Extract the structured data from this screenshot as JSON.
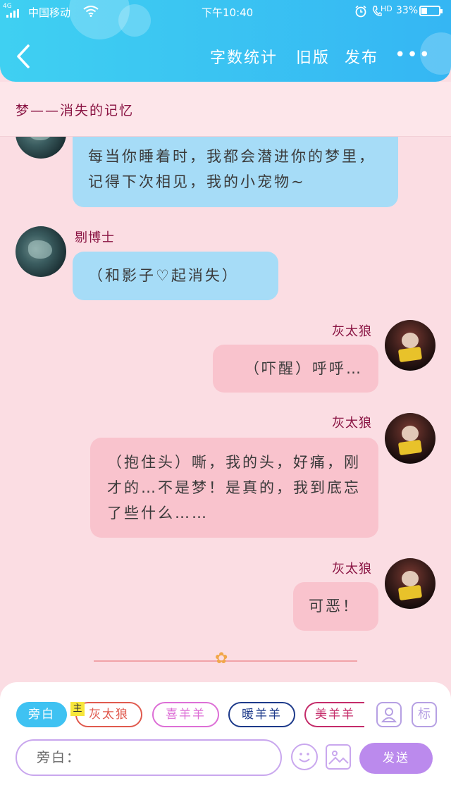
{
  "status_bar": {
    "network": "4G",
    "carrier": "中国移动",
    "time": "下午10:40",
    "hd": "HD",
    "battery": "33%",
    "battery_level": 0.33
  },
  "header": {
    "back_icon": "chevron-left-icon",
    "links": [
      "字数统计",
      "旧版",
      "发布"
    ],
    "more_icon": "more-dots-icon",
    "more": "•••"
  },
  "story_title": "梦——消失的记忆",
  "messages": [
    {
      "side": "left",
      "name": "",
      "avatar": "avatar-dr-doctor",
      "text": "每当你睡着时，我都会潜进你的梦里，记得下次相见，我的小宠物~"
    },
    {
      "side": "left",
      "name": "剔博士",
      "avatar": "avatar-dr-doctor",
      "text": "（和影子♡起消失）"
    },
    {
      "side": "right",
      "name": "灰太狼",
      "avatar": "avatar-grey-wolf",
      "text": "（吓醒）呼呼…"
    },
    {
      "side": "right",
      "name": "灰太狼",
      "avatar": "avatar-grey-wolf",
      "text": "（抱住头）嘶，我的头，好痛，刚才的…不是梦！是真的，我到底忘了些什么……"
    },
    {
      "side": "right",
      "name": "灰太狼",
      "avatar": "avatar-grey-wolf",
      "text": "可恶！"
    }
  ],
  "characters": {
    "narrator": "旁白",
    "badge": "主",
    "chips": [
      "灰太狼",
      "喜羊羊",
      "暖羊羊",
      "美羊羊"
    ],
    "chip_colors": [
      "#e05a4e",
      "#dd6fd6",
      "#1d3a8a",
      "#c42c6a"
    ],
    "add_character_icon": "person-icon",
    "tag_label": "标"
  },
  "composer": {
    "placeholder": "旁白：",
    "emoji_icon": "smiley-icon",
    "image_icon": "image-icon",
    "send_label": "发送"
  }
}
